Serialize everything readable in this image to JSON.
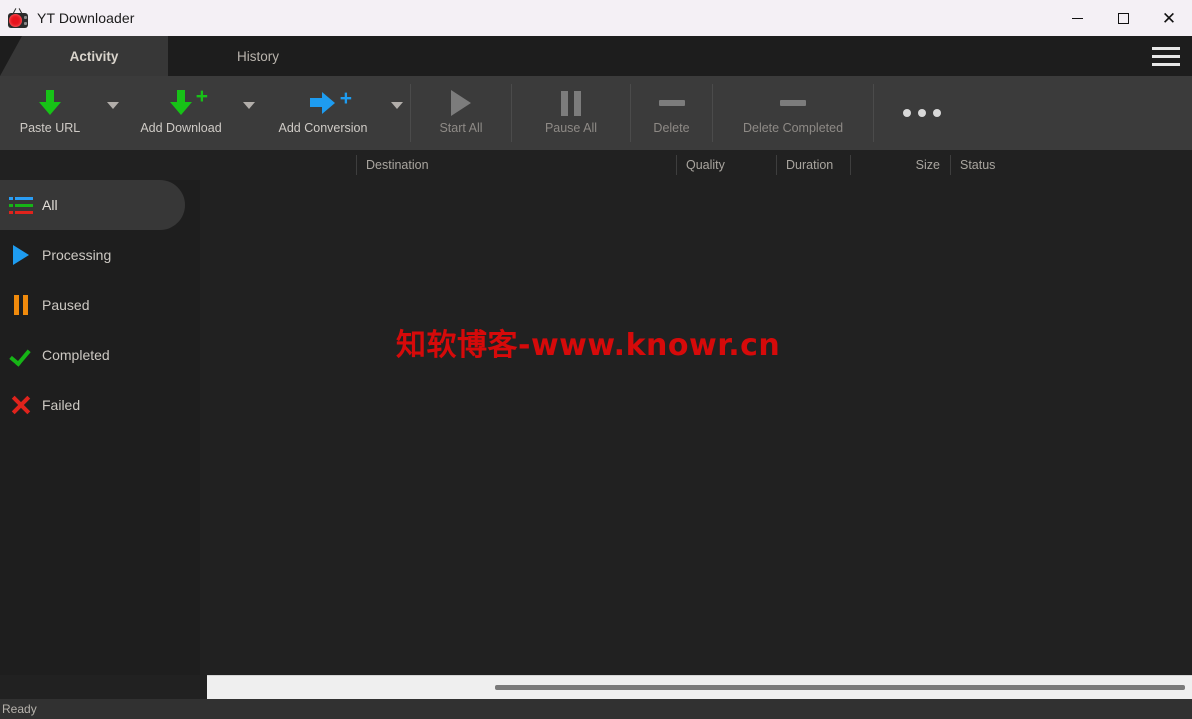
{
  "window": {
    "title": "YT Downloader",
    "app_icon": "tv-icon",
    "controls": {
      "minimize": "minimize-icon",
      "maximize": "maximize-icon",
      "close": "close-icon"
    }
  },
  "tabs": [
    {
      "label": "Activity",
      "active": true
    },
    {
      "label": "History",
      "active": false
    }
  ],
  "menu": {
    "icon": "hamburger-menu-icon"
  },
  "toolbar": {
    "items": [
      {
        "label": "Paste URL",
        "icon": "green-down-arrow-icon",
        "dropdown": true,
        "disabled": false
      },
      {
        "label": "Add Download",
        "icon": "green-down-arrow-plus-icon",
        "dropdown": true,
        "disabled": false
      },
      {
        "label": "Add Conversion",
        "icon": "blue-right-arrow-plus-icon",
        "dropdown": true,
        "disabled": false
      },
      {
        "label": "Start All",
        "icon": "play-icon",
        "dropdown": false,
        "disabled": true
      },
      {
        "label": "Pause All",
        "icon": "pause-icon",
        "dropdown": false,
        "disabled": true
      },
      {
        "label": "Delete",
        "icon": "minus-dash-icon",
        "dropdown": false,
        "disabled": true
      },
      {
        "label": "Delete Completed",
        "icon": "minus-dash-icon",
        "dropdown": false,
        "disabled": true
      },
      {
        "label": "",
        "icon": "overflow-dots-icon",
        "dropdown": false,
        "disabled": false
      }
    ]
  },
  "columns": [
    {
      "label": "Destination",
      "align": "left"
    },
    {
      "label": "Quality",
      "align": "left"
    },
    {
      "label": "Duration",
      "align": "left"
    },
    {
      "label": "Size",
      "align": "right"
    },
    {
      "label": "Status",
      "align": "left"
    }
  ],
  "sidebar": {
    "items": [
      {
        "label": "All",
        "icon": "colored-list-icon",
        "active": true
      },
      {
        "label": "Processing",
        "icon": "blue-play-icon",
        "active": false
      },
      {
        "label": "Paused",
        "icon": "orange-pause-icon",
        "active": false
      },
      {
        "label": "Completed",
        "icon": "green-check-icon",
        "active": false
      },
      {
        "label": "Failed",
        "icon": "red-x-icon",
        "active": false
      }
    ]
  },
  "content": {
    "rows": [],
    "watermark": "知软博客-www.knowr.cn"
  },
  "statusbar": {
    "text": "Ready"
  },
  "colors": {
    "accent_green": "#17c217",
    "accent_blue": "#1e9cf0",
    "accent_orange": "#f08a0c",
    "accent_red": "#e0231c",
    "titlebar_bg": "#f4f0f5",
    "toolbar_bg": "#3b3b3b",
    "content_bg": "#212121",
    "watermark_color": "#d60a0a"
  }
}
